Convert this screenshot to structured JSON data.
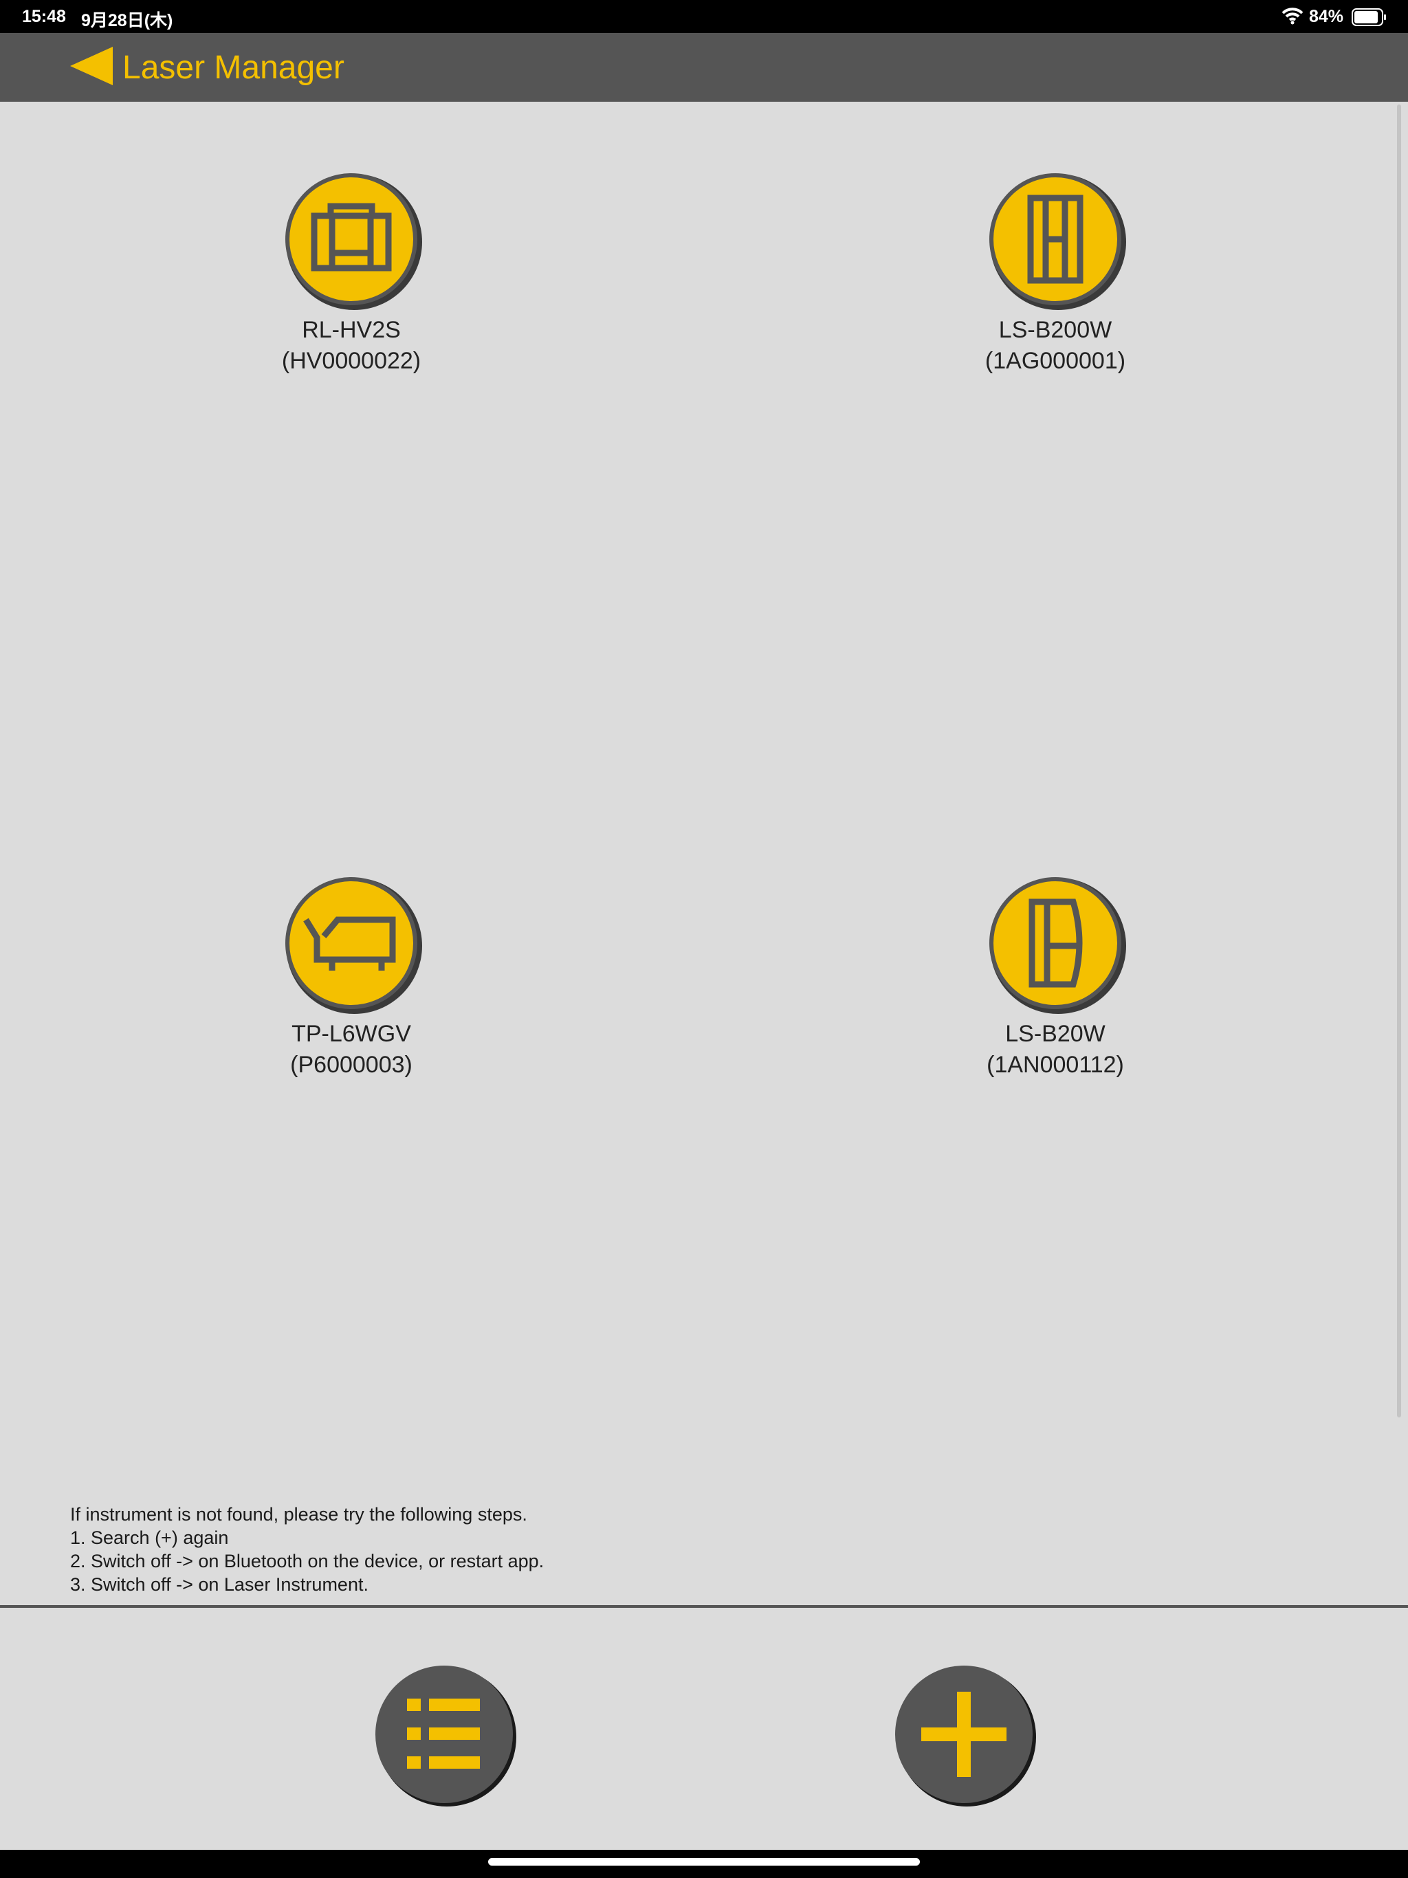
{
  "status_bar": {
    "time": "15:48",
    "date": "9月28日(木)",
    "battery_percent": "84%",
    "icons": [
      "wifi-icon",
      "battery-icon"
    ]
  },
  "nav": {
    "back_icon": "back-arrow-icon",
    "title": "Laser Manager"
  },
  "devices": [
    {
      "model": "RL-HV2S",
      "serial": "(HV0000022)",
      "icon": "rotating-laser-icon"
    },
    {
      "model": "LS-B200W",
      "serial": "(1AG000001)",
      "icon": "laser-sensor-icon"
    },
    {
      "model": "TP-L6WGV",
      "serial": "(P6000003)",
      "icon": "pipe-laser-icon"
    },
    {
      "model": "LS-B20W",
      "serial": "(1AN000112)",
      "icon": "laser-sensor-curved-icon"
    }
  ],
  "help": {
    "intro": "If instrument is not found, please try the following steps.",
    "step1": "1. Search (+) again",
    "step2": "2. Switch off -> on Bluetooth on the device, or restart app.",
    "step3": "3. Switch off -> on Laser Instrument."
  },
  "toolbar": {
    "list_icon": "list-icon",
    "add_icon": "plus-icon"
  },
  "colors": {
    "accent": "#f4c000",
    "dark": "#555555",
    "background": "#dcdcdc"
  }
}
